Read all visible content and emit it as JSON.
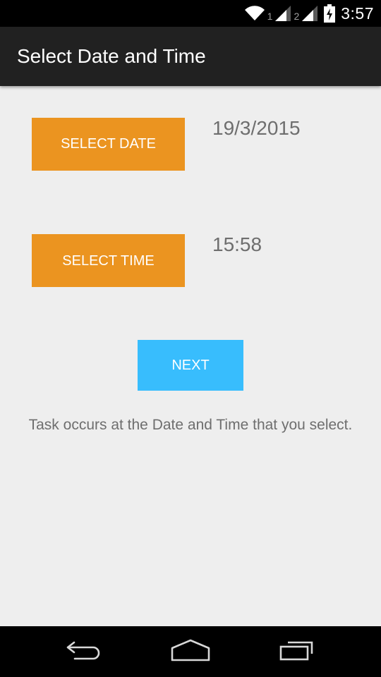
{
  "status_bar": {
    "time": "3:57",
    "sim1_label": "1",
    "sim2_label": "2",
    "icons": [
      "wifi-icon",
      "signal-icon",
      "signal-icon",
      "battery-charging-icon"
    ]
  },
  "action_bar": {
    "title": "Select Date and Time"
  },
  "main": {
    "select_date_label": "SELECT DATE",
    "date_value": "19/3/2015",
    "select_time_label": "SELECT TIME",
    "time_value": "15:58",
    "next_label": "NEXT",
    "caption": "Task occurs at the Date and Time that you select."
  },
  "nav_bar": {
    "icons": [
      "back-icon",
      "home-icon",
      "recent-apps-icon"
    ]
  },
  "colors": {
    "status_bar": "#000000",
    "action_bar": "#212121",
    "background": "#eeeeee",
    "orange_button": "#eb9420",
    "blue_button": "#38bdfd",
    "value_text": "#6e6e6e"
  }
}
